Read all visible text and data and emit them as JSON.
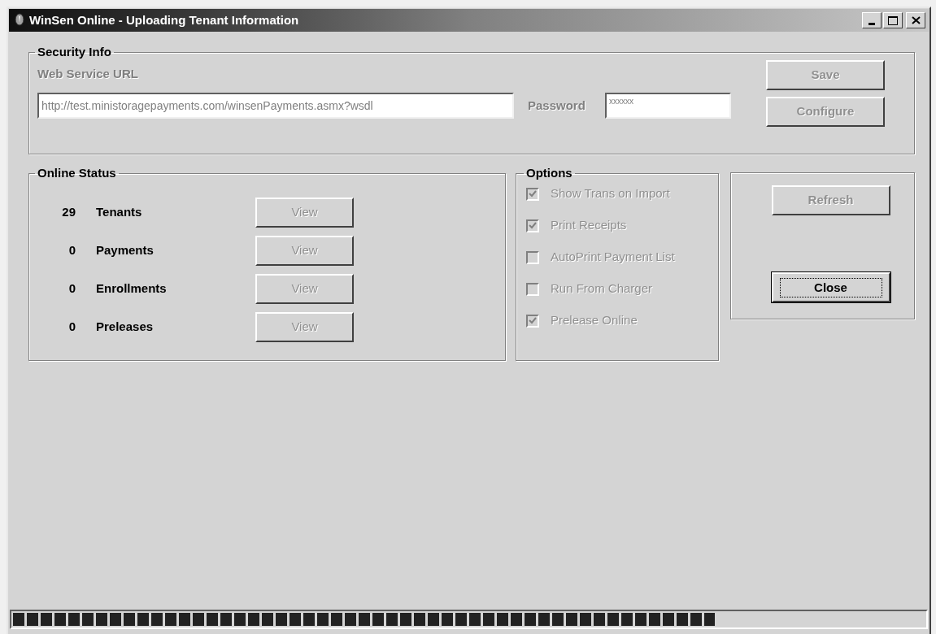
{
  "window": {
    "title": "WinSen Online - Uploading Tenant Information"
  },
  "security_info": {
    "title": "Security Info",
    "url_label": "Web Service URL",
    "url_value": "http://test.ministoragepayments.com/winsenPayments.asmx?wsdl",
    "password_label": "Password",
    "password_value": "xxxxxx",
    "buttons": [
      {
        "label": "Save",
        "disabled": true
      },
      {
        "label": "Configure",
        "disabled": true
      }
    ]
  },
  "online_status": {
    "title": "Online Status",
    "rows": [
      {
        "count": "29",
        "label": "Tenants",
        "button": "View",
        "disabled": true
      },
      {
        "count": "0",
        "label": "Payments",
        "button": "View",
        "disabled": true
      },
      {
        "count": "0",
        "label": "Enrollments",
        "button": "View",
        "disabled": true
      },
      {
        "count": "0",
        "label": "Preleases",
        "button": "View",
        "disabled": true
      }
    ]
  },
  "options": {
    "title": "Options",
    "items": [
      {
        "label": "Show Trans on Import",
        "checked": true,
        "disabled": true
      },
      {
        "label": "Print Receipts",
        "checked": true,
        "disabled": true
      },
      {
        "label": "AutoPrint Payment List",
        "checked": false,
        "disabled": true
      },
      {
        "label": "Run From Charger",
        "checked": false,
        "disabled": true
      },
      {
        "label": "Prelease Online",
        "checked": true,
        "disabled": true
      }
    ]
  },
  "actions": [
    {
      "label": "Refresh",
      "disabled": true,
      "default": false
    },
    {
      "label": "Close",
      "disabled": false,
      "default": true
    }
  ],
  "progress": {
    "level": 0.77
  }
}
